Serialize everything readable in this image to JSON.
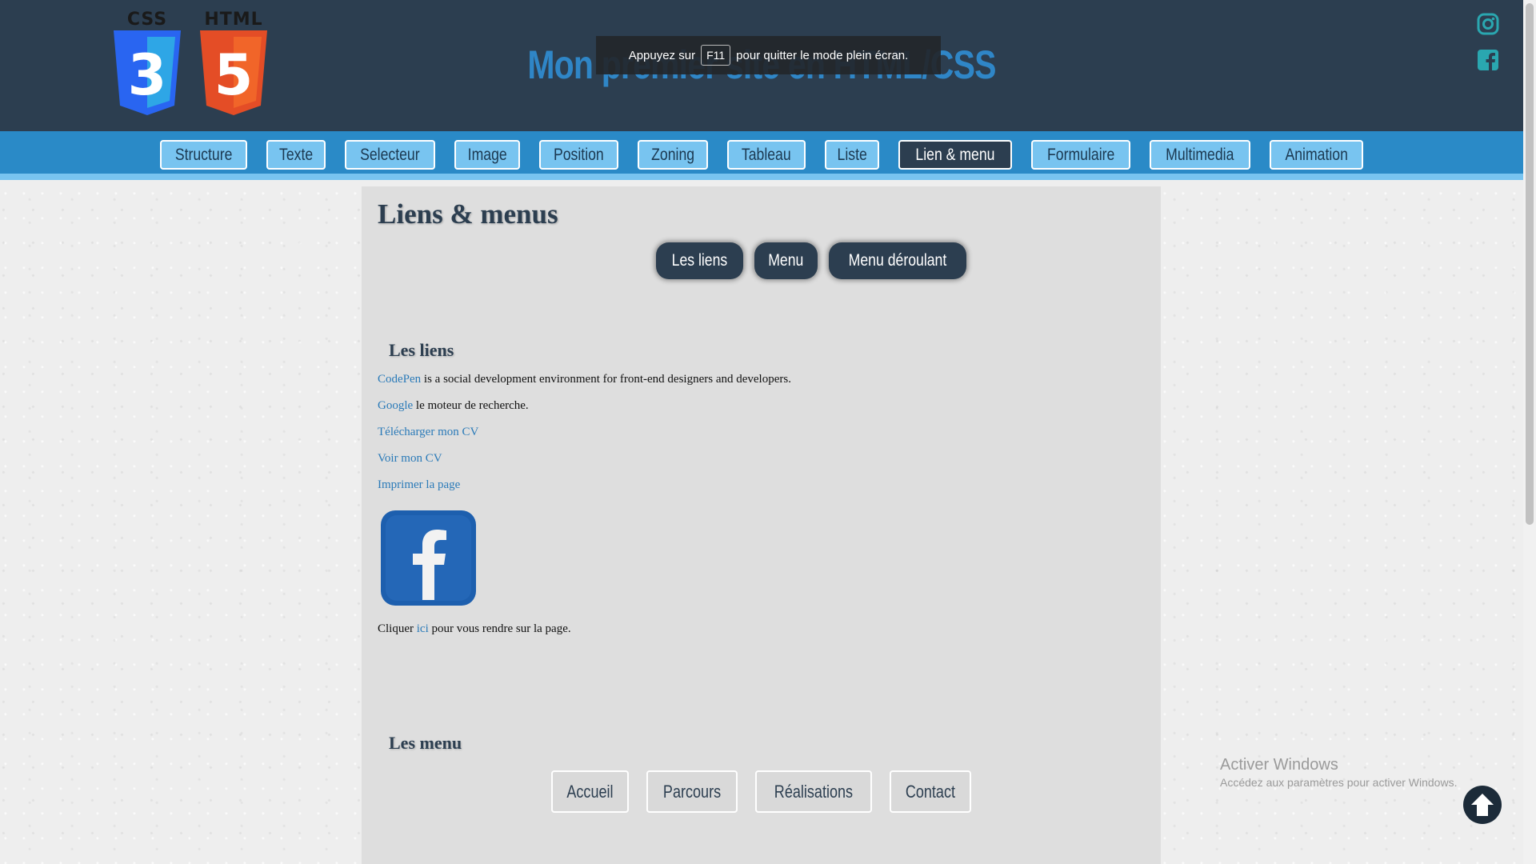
{
  "header": {
    "logo_css_text": "CSS",
    "logo_css_number": "3",
    "logo_html_text": "HTML",
    "logo_html_number": "5",
    "site_title": "Mon premier site en HTML/CSS",
    "fullscreen_notice": {
      "before": "Appuyez sur",
      "key": "F11",
      "after": "pour quitter le mode plein écran."
    },
    "social_icons": [
      "instagram-icon",
      "facebook-icon"
    ]
  },
  "nav": {
    "items": [
      {
        "label": "Structure"
      },
      {
        "label": "Texte"
      },
      {
        "label": "Selecteur"
      },
      {
        "label": "Image"
      },
      {
        "label": "Position"
      },
      {
        "label": "Zoning"
      },
      {
        "label": "Tableau"
      },
      {
        "label": "Liste"
      },
      {
        "label": "Lien & menu",
        "active": true
      },
      {
        "label": "Formulaire"
      },
      {
        "label": "Multimedia"
      },
      {
        "label": "Animation"
      }
    ]
  },
  "content": {
    "page_title": "Liens & menus",
    "pills": [
      "Les liens",
      "Menu",
      "Menu déroulant"
    ],
    "links_section": {
      "title": "Les liens",
      "codepen_link": "CodePen",
      "codepen_text": " is a social development environment for front-end designers and developers.",
      "google_link": "Google",
      "google_text": " le moteur de recherche.",
      "cv_download": "Télécharger mon CV",
      "cv_view": "Voir mon CV",
      "print": "Imprimer la page",
      "click_before": "Cliquer ",
      "click_link": "ici",
      "click_after": " pour vous rendre sur la page."
    },
    "menu_section": {
      "title": "Les menu",
      "items": [
        "Accueil",
        "Parcours",
        "Réalisations",
        "Contact"
      ]
    }
  },
  "watermark": {
    "line1": "Activer Windows",
    "line2": "Accédez aux paramètres pour activer Windows."
  },
  "colors": {
    "header_bg": "#2c3e50",
    "nav_bg": "#2a8ac7",
    "nav_btn_bg": "#78c4f0",
    "title_blue": "#2f86c7",
    "social_teal": "#2aa7b0",
    "css_blue": "#2965f1",
    "html_orange": "#e44d26"
  }
}
